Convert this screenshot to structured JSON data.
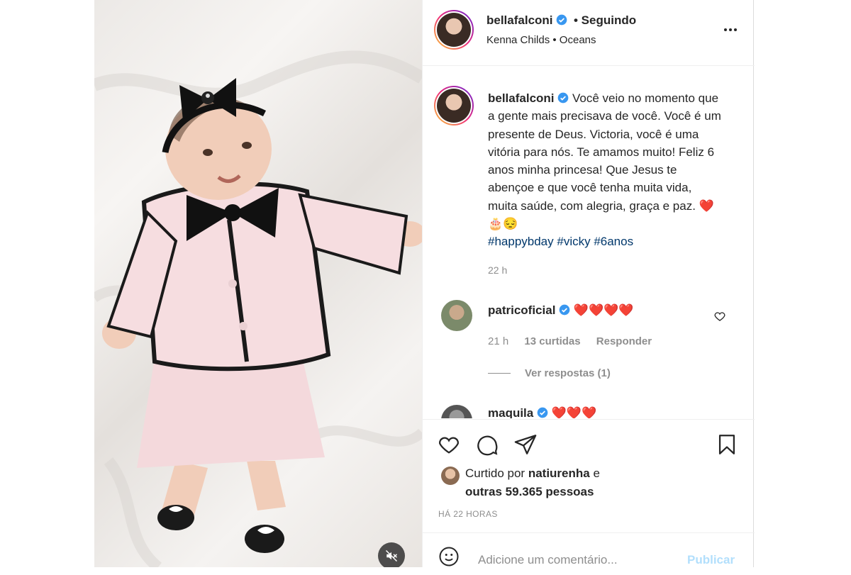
{
  "post": {
    "username": "bellafalconi",
    "follow_status": "• Seguindo",
    "audio": "Kenna Childs • Oceans",
    "more_icon": "ellipsis-icon"
  },
  "caption": {
    "username": "bellafalconi",
    "text": "Você veio no momento que a gente mais precisava de você. Você é um presente de Deus. Victoria, você é uma vitória para nós. Te amamos muito! Feliz 6 anos minha princesa! Que Jesus te abençoe e que você tenha muita vida, muita saúde, com alegria, graça e paz. ❤️🎂😔",
    "hashtags": "#happybday #vicky #6anos",
    "time_ago": "22 h"
  },
  "comments": [
    {
      "username": "patricoficial",
      "text": "❤️❤️❤️❤️",
      "time": "21 h",
      "likes": "13 curtidas",
      "reply": "Responder",
      "view_replies": "Ver respostas (1)"
    },
    {
      "username": "maquila",
      "text": "❤️❤️❤️"
    }
  ],
  "likes": {
    "prefix": "Curtido por ",
    "user": "natiurenha",
    "connector": " e",
    "others": "outras 59.365 pessoas"
  },
  "date": "HÁ 22 HORAS",
  "add_comment": {
    "placeholder": "Adicione um comentário...",
    "publish": "Publicar"
  },
  "colors": {
    "verified": "#3897f0",
    "link": "#00376b",
    "secondary": "#8e8e8e",
    "publish_disabled": "#b2dffc"
  }
}
